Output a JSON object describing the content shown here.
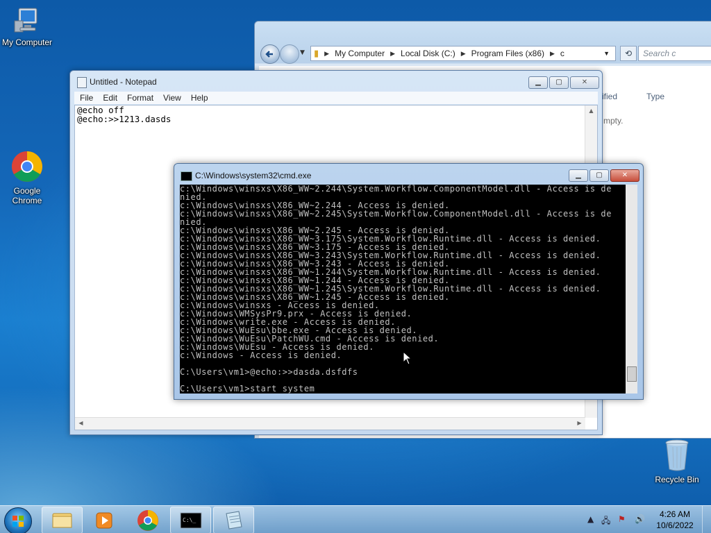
{
  "desktop": {
    "icons": [
      {
        "label": "My Computer"
      },
      {
        "label": "Google Chrome"
      },
      {
        "label": "Recycle Bin"
      }
    ]
  },
  "explorer": {
    "breadcrumb": [
      "My Computer",
      "Local Disk (C:)",
      "Program Files (x86)",
      "c"
    ],
    "search_placeholder": "Search c",
    "columns": [
      "ified",
      "Type"
    ],
    "empty_text": "mpty."
  },
  "notepad": {
    "title": "Untitled - Notepad",
    "menu": [
      "File",
      "Edit",
      "Format",
      "View",
      "Help"
    ],
    "text": "@echo off\n@echo:>>1213.dasds"
  },
  "cmd": {
    "title": "C:\\Windows\\system32\\cmd.exe",
    "lines": [
      "c:\\Windows\\winsxs\\X86_WW~2.244\\System.Workflow.ComponentModel.dll - Access is de",
      "nied.",
      "c:\\Windows\\winsxs\\X86_WW~2.244 - Access is denied.",
      "c:\\Windows\\winsxs\\X86_WW~2.245\\System.Workflow.ComponentModel.dll - Access is de",
      "nied.",
      "c:\\Windows\\winsxs\\X86_WW~2.245 - Access is denied.",
      "c:\\Windows\\winsxs\\X86_WW~3.175\\System.Workflow.Runtime.dll - Access is denied.",
      "c:\\Windows\\winsxs\\X86_WW~3.175 - Access is denied.",
      "c:\\Windows\\winsxs\\X86_WW~3.243\\System.Workflow.Runtime.dll - Access is denied.",
      "c:\\Windows\\winsxs\\X86_WW~3.243 - Access is denied.",
      "c:\\Windows\\winsxs\\X86_WW~1.244\\System.Workflow.Runtime.dll - Access is denied.",
      "c:\\Windows\\winsxs\\X86_WW~1.244 - Access is denied.",
      "c:\\Windows\\winsxs\\X86_WW~1.245\\System.Workflow.Runtime.dll - Access is denied.",
      "c:\\Windows\\winsxs\\X86_WW~1.245 - Access is denied.",
      "c:\\Windows\\winsxs - Access is denied.",
      "c:\\Windows\\WMSysPr9.prx - Access is denied.",
      "c:\\Windows\\write.exe - Access is denied.",
      "c:\\Windows\\WuEsu\\bbe.exe - Access is denied.",
      "c:\\Windows\\WuEsu\\PatchWU.cmd - Access is denied.",
      "c:\\Windows\\WuEsu - Access is denied.",
      "c:\\Windows - Access is denied.",
      "",
      "C:\\Users\\vm1>@echo:>>dasda.dsfdfs",
      "",
      "C:\\Users\\vm1>start system"
    ]
  },
  "taskbar": {
    "time": "4:26 AM",
    "date": "10/6/2022"
  }
}
